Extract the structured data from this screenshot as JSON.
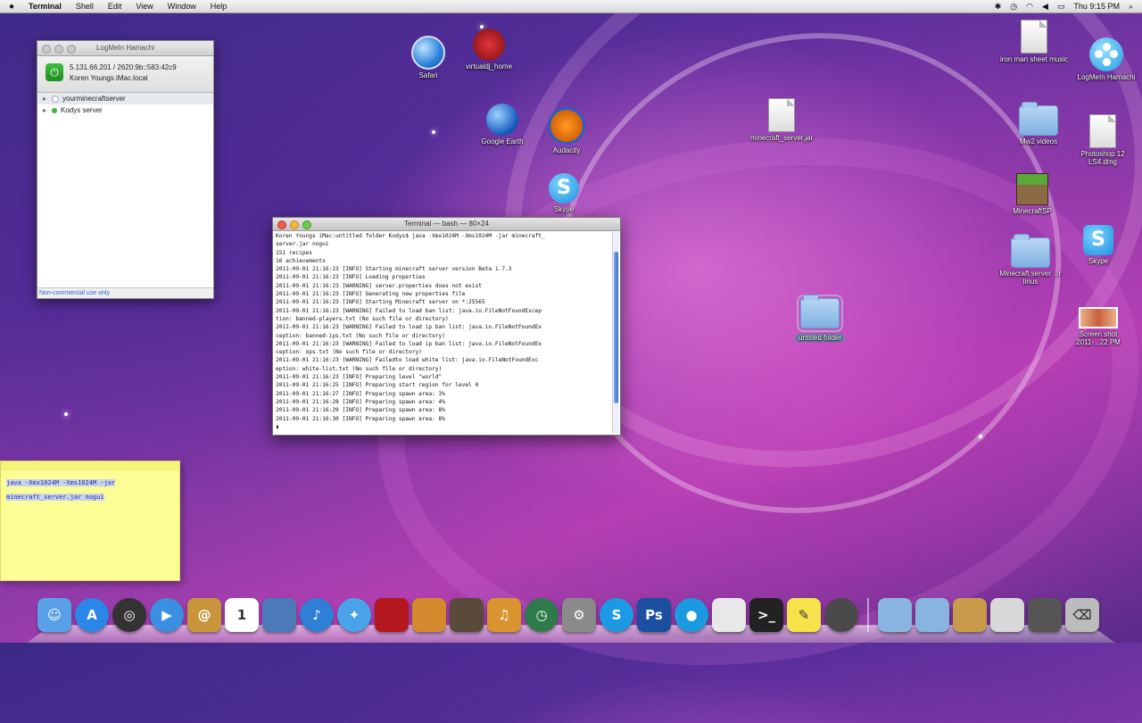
{
  "menubar": {
    "app": "Terminal",
    "menus": [
      "Shell",
      "Edit",
      "View",
      "Window",
      "Help"
    ],
    "clock": "Thu 9:15 PM"
  },
  "hamachi": {
    "title": "LogMeIn Hamachi",
    "ip": "5.131.66.201 / 2620:9b::583:42c9",
    "host": "Koren  Youngs  iMac.local",
    "networks": [
      {
        "name": "yourminecraftserver",
        "status": "offline"
      },
      {
        "name": "Kodys server",
        "status": "online"
      }
    ],
    "footer": "Non-commercial use only"
  },
  "terminal": {
    "title": "Terminal — bash — 80×24",
    "lines": [
      "Koren Youngs iMac:untitled folder Kodys$ java -Xmx1024M -Xms1024M -jar minecraft_",
      "server.jar nogui",
      "151 recipes",
      "16 achievements",
      "2011-09-01 21:16:23 [INFO] Starting minecraft server version Beta 1.7.3",
      "2011-09-01 21:16:23 [INFO] Loading properties",
      "2011-09-01 21:16:23 [WARNING] server.properties does not exist",
      "2011-09-01 21:16:23 [INFO] Generating new properties file",
      "2011-09-01 21:16:23 [INFO] Starting Minecraft server on *:25565",
      "2011-09-01 21:16:23 [WARNING] Failed to load ban list: java.io.FileNotFoundExcep",
      "tion: banned-players.txt (No such file or directory)",
      "2011-09-01 21:16:23 [WARNING] Failed to load ip ban list: java.io.FileNotFoundEx",
      "ception: banned-ips.txt (No such file or directory)",
      "2011-09-01 21:16:23 [WARNING] Failed to load ip ban list: java.io.FileNotFoundEx",
      "ception: ops.txt (No such file or directory)",
      "2011-09-01 21:16:23 [WARNING] Failedto load white list: java.io.FileNotFoundExc",
      "eption: white-list.txt (No such file or directory)",
      "2011-09-01 21:16:23 [INFO] Preparing level \"world\"",
      "2011-09-01 21:16:25 [INFO] Preparing start region for level 0",
      "2011-09-01 21:16:27 [INFO] Preparing spawn area: 3%",
      "2011-09-01 21:16:28 [INFO] Preparing spawn area: 4%",
      "2011-09-01 21:16:29 [INFO] Preparing spawn area: 8%",
      "2011-09-01 21:16:30 [INFO] Preparing spawn area: 8%",
      "▮"
    ]
  },
  "sticky": {
    "line1": "java -Xmx1024M -Xms1024M -jar",
    "line2": "minecraft_server.jar nogui"
  },
  "desktop_icons": {
    "safari": "Safari",
    "virtualdj": "virtualdj_home",
    "google_earth": "Google Earth",
    "audacity": "Audacity",
    "skype_mid": "Skype",
    "minecraft_jar": "minecraft_server.jar",
    "iron_man": "iron man sheet music",
    "hamachi": "LogMeIn Hamachi",
    "mw2": "Mw2 videos",
    "photoshop": "Photoshop 12 LS4.dmg",
    "minecraftsp": "MinecraftSP",
    "skype": "Skype",
    "minecraft_server_folder": "Minecraft server ...r linus",
    "untitled": "untitled folder",
    "screenshot": "Screen shot 2011-...22 PM"
  },
  "dock": {
    "apps": [
      {
        "name": "Finder",
        "icon": "finder-icon",
        "color": "#5aa0e6"
      },
      {
        "name": "App Store",
        "icon": "app-store-icon",
        "color": "#2c86e8"
      },
      {
        "name": "Dashboard",
        "icon": "dashboard-icon",
        "color": "#333333"
      },
      {
        "name": "FaceTime",
        "icon": "facetime-icon",
        "color": "#3a8fe0"
      },
      {
        "name": "Address Book",
        "icon": "address-book-icon",
        "color": "#c8953c"
      },
      {
        "name": "iCal",
        "icon": "ical-icon",
        "color": "#ffffff"
      },
      {
        "name": "iPhoto",
        "icon": "iphoto-icon",
        "color": "#4c7ab8"
      },
      {
        "name": "iTunes",
        "icon": "itunes-icon",
        "color": "#2f7fd6"
      },
      {
        "name": "Safari",
        "icon": "safari-icon",
        "color": "#4aa3e8"
      },
      {
        "name": "Photo Booth",
        "icon": "photo-booth-icon",
        "color": "#b3181f"
      },
      {
        "name": "iPhoto Library",
        "icon": "photo-icon",
        "color": "#d48a2c"
      },
      {
        "name": "iMovie",
        "icon": "imovie-icon",
        "color": "#5a4a3a"
      },
      {
        "name": "GarageBand",
        "icon": "garageband-icon",
        "color": "#d9942f"
      },
      {
        "name": "Time Machine",
        "icon": "time-machine-icon",
        "color": "#2d7a4a"
      },
      {
        "name": "System Preferences",
        "icon": "system-preferences-icon",
        "color": "#8a8a8a"
      },
      {
        "name": "Skype",
        "icon": "skype-icon",
        "color": "#1c9ae6"
      },
      {
        "name": "Photoshop",
        "icon": "photoshop-icon",
        "color": "#1b4fa0"
      },
      {
        "name": "Hamachi",
        "icon": "hamachi-icon",
        "color": "#1a9ae0"
      },
      {
        "name": "Script Editor",
        "icon": "script-icon",
        "color": "#e8e8e8"
      },
      {
        "name": "Terminal",
        "icon": "terminal-icon",
        "color": "#222222"
      },
      {
        "name": "Stickies",
        "icon": "stickies-icon",
        "color": "#f6e24a"
      },
      {
        "name": "VirtualDJ",
        "icon": "virtualdj-icon",
        "color": "#4a4a4a"
      }
    ],
    "stacks": [
      {
        "name": "Applications",
        "icon": "applications-folder-icon",
        "color": "#8ab4e0"
      },
      {
        "name": "Documents",
        "icon": "documents-folder-icon",
        "color": "#8ab4e0"
      },
      {
        "name": "Pictures",
        "icon": "pictures-stack-icon",
        "color": "#c99a4a"
      },
      {
        "name": "Downloads",
        "icon": "downloads-stack-icon",
        "color": "#d8d8d8"
      },
      {
        "name": "Preview",
        "icon": "preview-icon",
        "color": "#555555"
      },
      {
        "name": "Trash",
        "icon": "trash-icon",
        "color": "#bcbcbc"
      }
    ]
  }
}
